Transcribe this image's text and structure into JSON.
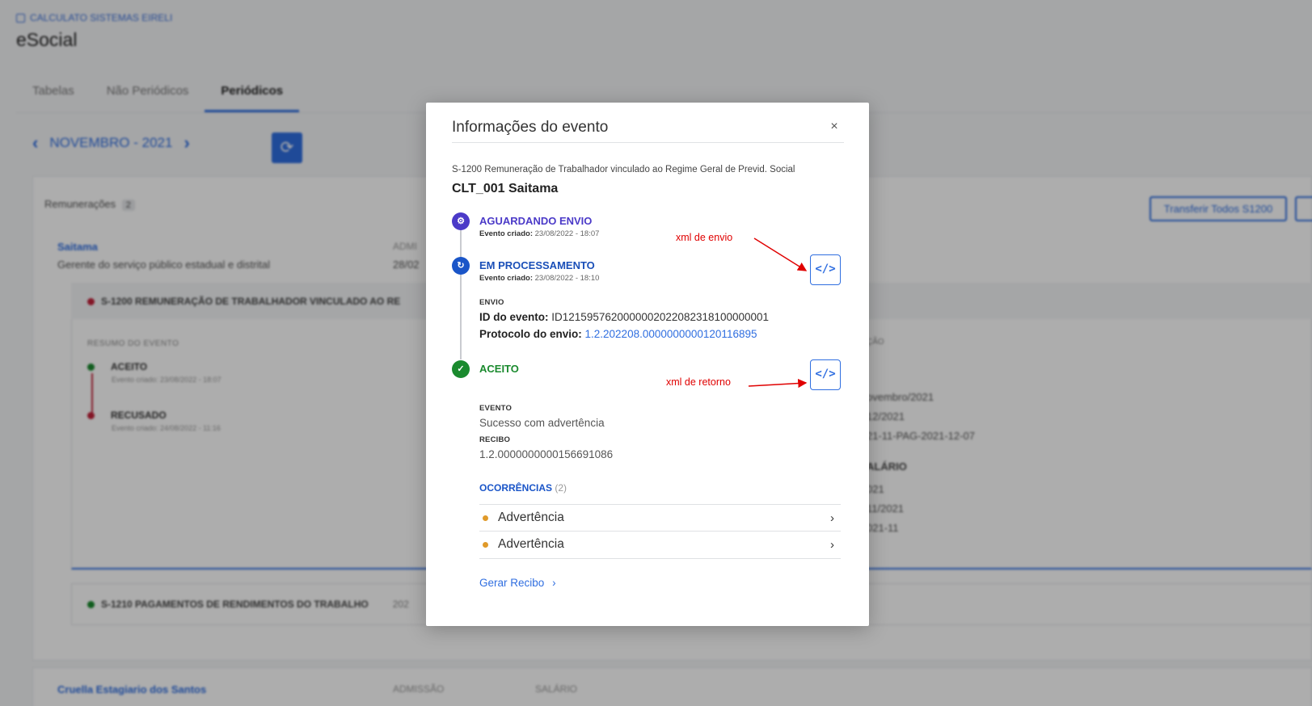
{
  "background": {
    "company": "CALCULATO SISTEMAS EIRELI",
    "app_title": "eSocial",
    "tabs": [
      "Tabelas",
      "Não Periódicos",
      "Periódicos"
    ],
    "month": "NOVEMBRO - 2021",
    "remuneracoes_label": "Remunerações",
    "remuneracoes_count": "2",
    "transfer_button": "Transferir Todos S1200",
    "employee1": {
      "name": "Saitama",
      "role": "Gerente do serviço público estadual e distrital",
      "admissao_label": "ADMI",
      "admissao_value": "28/02"
    },
    "s1200_header": "S-1200 REMUNERAÇÃO DE TRABALHADOR VINCULADO AO RE",
    "resumo_label": "RESUMO DO EVENTO",
    "timeline": [
      {
        "status": "ACEITO",
        "sub": "Evento criado: 23/08/2022 - 18:07"
      },
      {
        "status": "RECUSADO",
        "sub": "Evento criado: 24/08/2022 - 11:16"
      }
    ],
    "right_values": [
      "ÇÃO",
      "ovembro/2021",
      "12/2021",
      "21-11-PAG-2021-12-07",
      "ALÁRIO",
      "021",
      "11/2021",
      "021-11"
    ],
    "s1210_header": "S-1210 PAGAMENTOS DE RENDIMENTOS DO TRABALHO",
    "s1210_extra": "202",
    "employee2": {
      "name": "Cruella Estagiario dos Santos",
      "admissao_label": "ADMISSÃO",
      "salario_label": "SALÁRIO"
    }
  },
  "modal": {
    "title": "Informações do evento",
    "close": "×",
    "event_description": "S-1200 Remuneração de Trabalhador vinculado ao Regime Geral de Previd. Social",
    "worker": "CLT_001 Saitama",
    "steps": [
      {
        "icon": "⚙",
        "title": "AGUARDANDO ENVIO",
        "created_label": "Evento criado:",
        "created_value": "23/08/2022 - 18:07"
      },
      {
        "icon": "↻",
        "title": "EM PROCESSAMENTO",
        "created_label": "Evento criado:",
        "created_value": "23/08/2022 - 18:10"
      },
      {
        "icon": "✓",
        "title": "ACEITO"
      }
    ],
    "envio_label": "ENVIO",
    "id_evento_label": "ID do evento:",
    "id_evento_value": "ID1215957620000002022082318100000001",
    "protocolo_label": "Protocolo do envio:",
    "protocolo_value": "1.2.202208.0000000000120116895",
    "evento_label": "EVENTO",
    "evento_value": "Sucesso com advertência",
    "recibo_label": "RECIBO",
    "recibo_value": "1.2.0000000000156691086",
    "ocorrencias_label": "OCORRÊNCIAS",
    "ocorrencias_count": "(2)",
    "ocorrencias": [
      "Advertência",
      "Advertência"
    ],
    "gerar_recibo": "Gerar Recibo",
    "xml_button_glyph": "</>"
  },
  "annotations": {
    "xml_envio": "xml de envio",
    "xml_retorno": "xml de retorno",
    "color": "#e00000"
  },
  "colors": {
    "accent": "#2f6ee0",
    "purple_status": "#4b3ac8",
    "blue_status": "#1a55c8",
    "green_status": "#1a8a2e",
    "warning_dot": "#e09a2a"
  }
}
